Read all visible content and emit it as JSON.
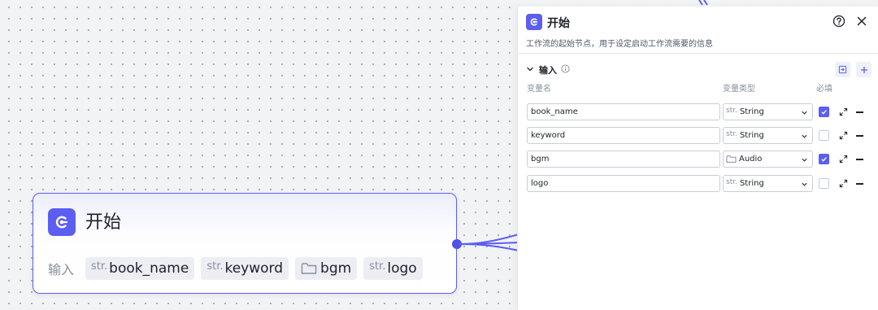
{
  "node": {
    "title": "开始",
    "input_label": "输入",
    "chips": [
      {
        "type": "str.",
        "name": "book_name",
        "icon": "string-type"
      },
      {
        "type": "str.",
        "name": "keyword",
        "icon": "string-type"
      },
      {
        "type": "",
        "name": "bgm",
        "icon": "folder-icon"
      },
      {
        "type": "str.",
        "name": "logo",
        "icon": "string-type"
      }
    ]
  },
  "panel": {
    "title": "开始",
    "description": "工作流的起始节点，用于设定启动工作流需要的信息",
    "section_title": "输入",
    "columns": {
      "name": "变量名",
      "type": "变量类型",
      "required": "必填"
    },
    "variables": [
      {
        "name": "book_name",
        "type_prefix": "str.",
        "type": "String",
        "required": true
      },
      {
        "name": "keyword",
        "type_prefix": "str.",
        "type": "String",
        "required": false
      },
      {
        "name": "bgm",
        "type_prefix": "",
        "type": "Audio",
        "required": true,
        "type_icon": "folder-icon"
      },
      {
        "name": "logo",
        "type_prefix": "str.",
        "type": "String",
        "required": false
      }
    ]
  },
  "colors": {
    "accent": "#5b5ef0",
    "canvas": "#f2f3f5",
    "text": "#1d2129",
    "muted": "#86909c"
  }
}
